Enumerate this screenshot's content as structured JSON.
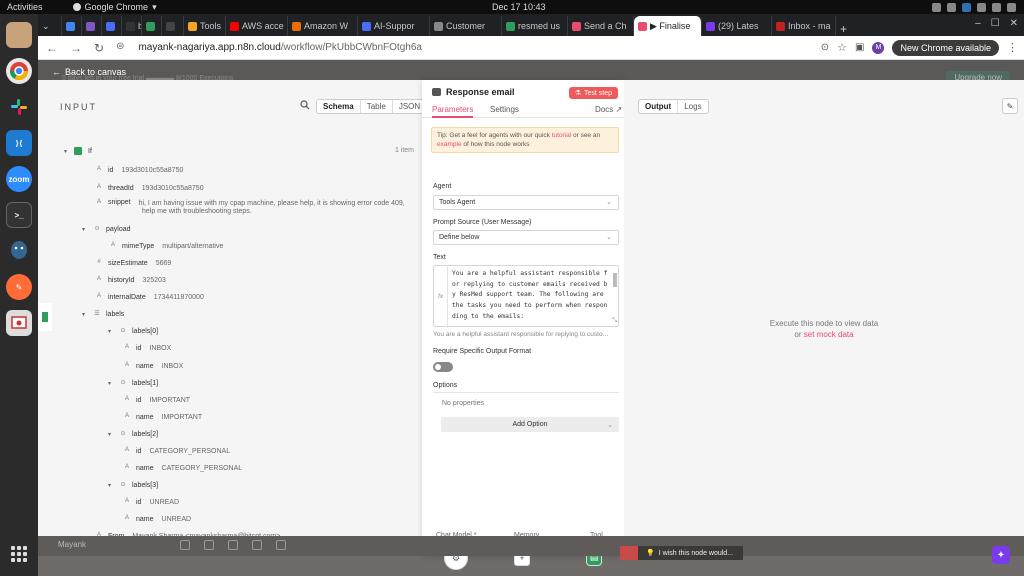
{
  "os": {
    "activities": "Activities",
    "app_name": "Google Chrome",
    "clock": "Dec 17  10:43"
  },
  "dock": {
    "apps": [
      "files",
      "chrome",
      "slack",
      "vscode",
      "zoom",
      "terminal",
      "postgres",
      "postman",
      "screenshot"
    ],
    "zoom_label": "zoom"
  },
  "browser": {
    "tabs": [
      {
        "label": "",
        "color": "#4285f4"
      },
      {
        "label": "",
        "color": "#7e57c2"
      },
      {
        "label": "",
        "color": "#4a6cf7"
      },
      {
        "label": "b",
        "color": "#333333"
      },
      {
        "label": "",
        "color": "#2f9d5b"
      },
      {
        "label": "",
        "color": "#444444"
      },
      {
        "label": "Tools",
        "color": "#f5a623"
      },
      {
        "label": "AWS acce",
        "color": "#f90000"
      },
      {
        "label": "Amazon W",
        "color": "#ef6c00"
      },
      {
        "label": "AI-Suppor",
        "color": "#4a6cf7"
      },
      {
        "label": "Customer",
        "color": "#888888"
      },
      {
        "label": "resmed us",
        "color": "#2f9d5b"
      },
      {
        "label": "Send a Ch",
        "color": "#ea4b71"
      },
      {
        "label": "▶ Finalise",
        "color": "#ea4b71"
      },
      {
        "label": "(29) Lates",
        "color": "#7c3aed"
      },
      {
        "label": "Inbox - ma",
        "color": "#c5221f"
      }
    ],
    "url_host": "mayank-nagariya.app.n8n.cloud",
    "url_path": "/workflow/PkUbbCWbnFOtgh6a",
    "new_chrome": "New Chrome available",
    "avatar_letter": "M"
  },
  "canvas": {
    "back_label": "Back to canvas",
    "trial_text": "5 days left in your free trial   ▬▬▬▬   8/1000 Executions",
    "upgrade_label": "Upgrade now",
    "user_name": "Mayank"
  },
  "input_panel": {
    "title": "INPUT",
    "view_tabs": [
      "Schema",
      "Table",
      "JSON"
    ],
    "node_name": "If",
    "item_count": "1 item",
    "rows": [
      {
        "type": "A",
        "key": "id",
        "value": "193d3010c55a8750",
        "indent": 0
      },
      {
        "type": "A",
        "key": "threadId",
        "value": "193d3010c55a8750",
        "indent": 0
      },
      {
        "type": "A",
        "key": "snippet",
        "value": "hi, I am having issue with my cpap machine, please help, it is showing error code 409,",
        "value2": "help me with troubleshooting steps.",
        "indent": 0
      },
      {
        "type": "obj",
        "key": "payload",
        "value": "",
        "indent": -1
      },
      {
        "type": "A",
        "key": "mimeType",
        "value": "multipart/alternative",
        "indent": 1
      },
      {
        "type": "#",
        "key": "sizeEstimate",
        "value": "5669",
        "indent": 0
      },
      {
        "type": "A",
        "key": "historyId",
        "value": "325203",
        "indent": 0
      },
      {
        "type": "A",
        "key": "internalDate",
        "value": "1734411870000",
        "indent": 0
      },
      {
        "type": "list",
        "key": "labels",
        "value": "",
        "indent": -1
      },
      {
        "type": "obj",
        "key": "labels[0]",
        "value": "",
        "indent": 0.5
      },
      {
        "type": "A",
        "key": "id",
        "value": "INBOX",
        "indent": 2
      },
      {
        "type": "A",
        "key": "name",
        "value": "INBOX",
        "indent": 2
      },
      {
        "type": "obj",
        "key": "labels[1]",
        "value": "",
        "indent": 0.5
      },
      {
        "type": "A",
        "key": "id",
        "value": "IMPORTANT",
        "indent": 2
      },
      {
        "type": "A",
        "key": "name",
        "value": "IMPORTANT",
        "indent": 2
      },
      {
        "type": "obj",
        "key": "labels[2]",
        "value": "",
        "indent": 0.5
      },
      {
        "type": "A",
        "key": "id",
        "value": "CATEGORY_PERSONAL",
        "indent": 2
      },
      {
        "type": "A",
        "key": "name",
        "value": "CATEGORY_PERSONAL",
        "indent": 2
      },
      {
        "type": "obj",
        "key": "labels[3]",
        "value": "",
        "indent": 0.5
      },
      {
        "type": "A",
        "key": "id",
        "value": "UNREAD",
        "indent": 2
      },
      {
        "type": "A",
        "key": "name",
        "value": "UNREAD",
        "indent": 2
      },
      {
        "type": "A",
        "key": "From",
        "value": "Mayank Sharma <mayanksharma@bitcot.com>",
        "indent": 0
      },
      {
        "type": "A",
        "key": "Subject",
        "value": "Regarding CPAP troubleshoot",
        "indent": 0
      }
    ]
  },
  "node_panel": {
    "title": "Response email",
    "test_step": "Test step",
    "tabs": [
      "Parameters",
      "Settings"
    ],
    "docs": "Docs",
    "tip_prefix": "Tip: Get a feel for agents with our quick ",
    "tip_link1": "tutorial",
    "tip_mid": " or see an",
    "tip_link2": "example",
    "tip_suffix": " of how this node works",
    "agent_label": "Agent",
    "agent_value": "Tools Agent",
    "prompt_label": "Prompt Source (User Message)",
    "prompt_value": "Define below",
    "text_label": "Text",
    "text_lines": [
      "You are a helpful assistant responsible f",
      "or replying to customer emails received b",
      "y ResMed support team. The following are",
      "the tasks you need to perform when respon",
      "ding to the emails:"
    ],
    "text_preview": "You are a helpful assistant responsible for replying to custo...",
    "output_format_label": "Require Specific Output Format",
    "options_label": "Options",
    "no_properties": "No properties",
    "add_option": "Add Option",
    "subnodes": [
      "Chat Model *",
      "Memory",
      "Tool"
    ]
  },
  "output_panel": {
    "tabs": [
      "Output",
      "Logs"
    ],
    "message_line1": "Execute this node to view data",
    "message_or": "or ",
    "message_link": "set mock data"
  },
  "feedback": {
    "wish_text": "I wish this node would..."
  }
}
